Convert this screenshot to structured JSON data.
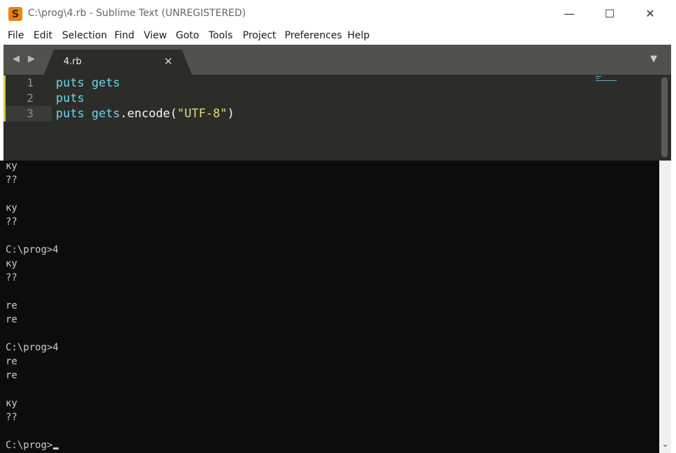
{
  "window": {
    "title": "C:\\prog\\4.rb - Sublime Text (UNREGISTERED)",
    "app_icon_letter": "S",
    "minimize_glyph": "—",
    "maximize_glyph": "☐",
    "close_glyph": "✕"
  },
  "menu": {
    "items": [
      "File",
      "Edit",
      "Selection",
      "Find",
      "View",
      "Goto",
      "Tools",
      "Project",
      "Preferences",
      "Help"
    ]
  },
  "tabs": {
    "nav_arrows": "◀ ▶",
    "active": {
      "label": "4.rb",
      "close_glyph": "✕"
    },
    "dropdown_glyph": "▼"
  },
  "editor": {
    "lines": [
      {
        "number": "1",
        "tokens": [
          {
            "text": "puts ",
            "kind": "kw"
          },
          {
            "text": "gets",
            "kind": "kw"
          }
        ]
      },
      {
        "number": "2",
        "tokens": [
          {
            "text": "puts",
            "kind": "kw"
          }
        ]
      },
      {
        "number": "3",
        "tokens": [
          {
            "text": "puts ",
            "kind": "kw"
          },
          {
            "text": "gets",
            "kind": "kw"
          },
          {
            "text": ".encode(",
            "kind": "plain"
          },
          {
            "text": "\"UTF-8\"",
            "kind": "str"
          },
          {
            "text": ")",
            "kind": "plain"
          }
        ]
      }
    ],
    "current_line": "3",
    "colors": {
      "keyword": "#66d9ef",
      "string": "#e6db74",
      "plain": "#f8f8f2",
      "background": "#2c2d29"
    }
  },
  "console": {
    "lines": [
      "ку",
      "??",
      "",
      "ку",
      "??",
      "",
      "C:\\prog>4",
      "ку",
      "??",
      "",
      "re",
      "re",
      "",
      "C:\\prog>4",
      "re",
      "re",
      "",
      "ку",
      "??",
      "",
      "C:\\prog>"
    ],
    "scroll_down_glyph": "⌄"
  }
}
